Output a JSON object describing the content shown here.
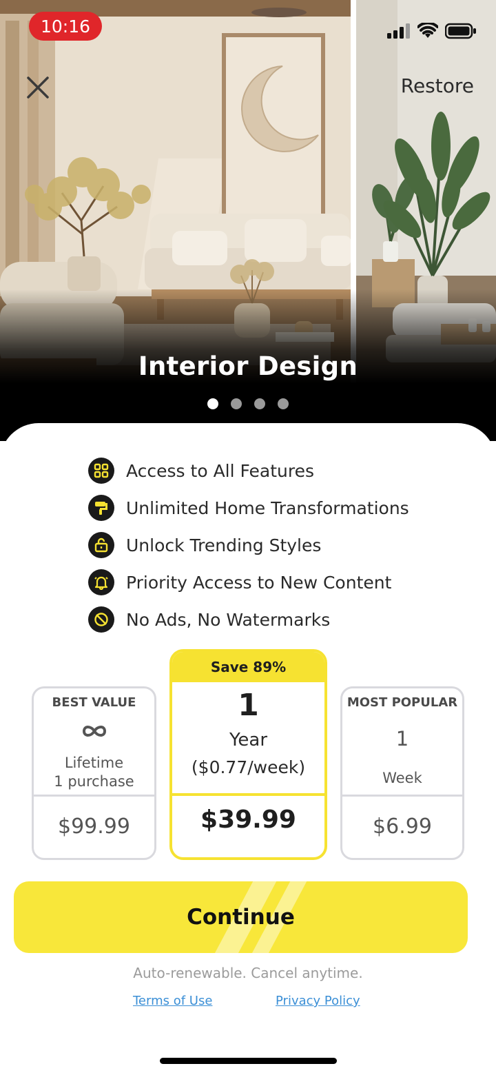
{
  "status_bar": {
    "time": "10:16",
    "time_pill_color": "#e0262a"
  },
  "header": {
    "close_icon": "close-icon",
    "restore_label": "Restore"
  },
  "hero": {
    "title": "Interior Design",
    "pager_total": 4,
    "pager_active": 1
  },
  "features": [
    {
      "icon": "grid-icon",
      "label": "Access to All Features"
    },
    {
      "icon": "paint-roller-icon",
      "label": "Unlimited Home Transformations"
    },
    {
      "icon": "unlock-icon",
      "label": "Unlock Trending Styles"
    },
    {
      "icon": "bell-icon",
      "label": "Priority Access to New Content"
    },
    {
      "icon": "no-ads-icon",
      "label": "No Ads, No Watermarks"
    }
  ],
  "plans": {
    "lifetime": {
      "badge": "BEST VALUE",
      "icon": "infinity-icon",
      "line1": "Lifetime",
      "line2": "1 purchase",
      "price": "$99.99"
    },
    "year": {
      "badge": "Save 89%",
      "quantity": "1",
      "unit": "Year",
      "per_week": "($0.77/week)",
      "price": "$39.99",
      "selected": true
    },
    "week": {
      "badge": "MOST POPULAR",
      "quantity": "1",
      "unit": "Week",
      "price": "$6.99"
    }
  },
  "cta": {
    "label": "Continue"
  },
  "footer": {
    "fine_print": "Auto-renewable. Cancel anytime.",
    "terms": "Terms of Use",
    "privacy": "Privacy Policy"
  },
  "colors": {
    "accent": "#f6e231",
    "link": "#3b8fd6",
    "border": "#d9d9de"
  }
}
